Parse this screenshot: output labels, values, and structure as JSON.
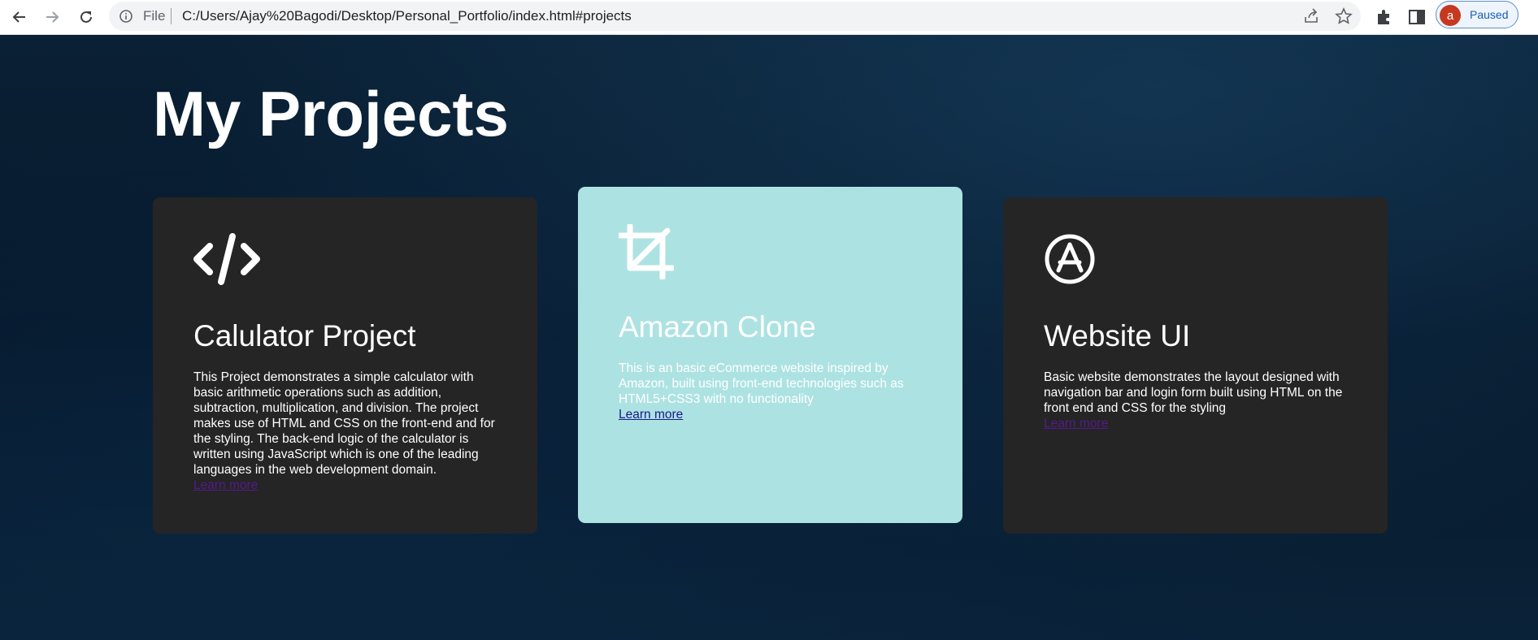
{
  "browser": {
    "scheme_label": "File",
    "url": "C:/Users/Ajay%20Bagodi/Desktop/Personal_Portfolio/index.html#projects",
    "profile_initial": "a",
    "profile_status": "Paused",
    "icons": [
      "back-arrow-icon",
      "forward-arrow-icon",
      "reload-icon",
      "info-icon",
      "share-icon",
      "star-icon",
      "extensions-icon",
      "side-panel-icon"
    ]
  },
  "page": {
    "heading": "My Projects",
    "cards": [
      {
        "icon": "code-icon",
        "title": "Calulator Project",
        "description": "This Project demonstrates a simple calculator with basic arithmetic operations such as addition, subtraction, multiplication, and division. The project makes use of HTML and CSS on the front-end and for the styling. The back-end logic of the calculator is written using JavaScript which is one of the leading languages in the web development domain.",
        "link": "Learn more"
      },
      {
        "icon": "crop-icon",
        "title": "Amazon Clone",
        "description": "This is an basic eCommerce website inspired by Amazon, built using front-end technologies such as HTML5+CSS3 with no functionality",
        "link": "Learn more"
      },
      {
        "icon": "app-store-icon",
        "title": "Website UI",
        "description": "Basic website demonstrates the layout designed with navigation bar and login form built using HTML on the front end and CSS for the styling",
        "link": "Learn more"
      }
    ]
  },
  "colors": {
    "card_dark": "#252525",
    "card_highlight": "#ade2e2",
    "visited_link": "#551a8b",
    "background": "#071a2c"
  }
}
